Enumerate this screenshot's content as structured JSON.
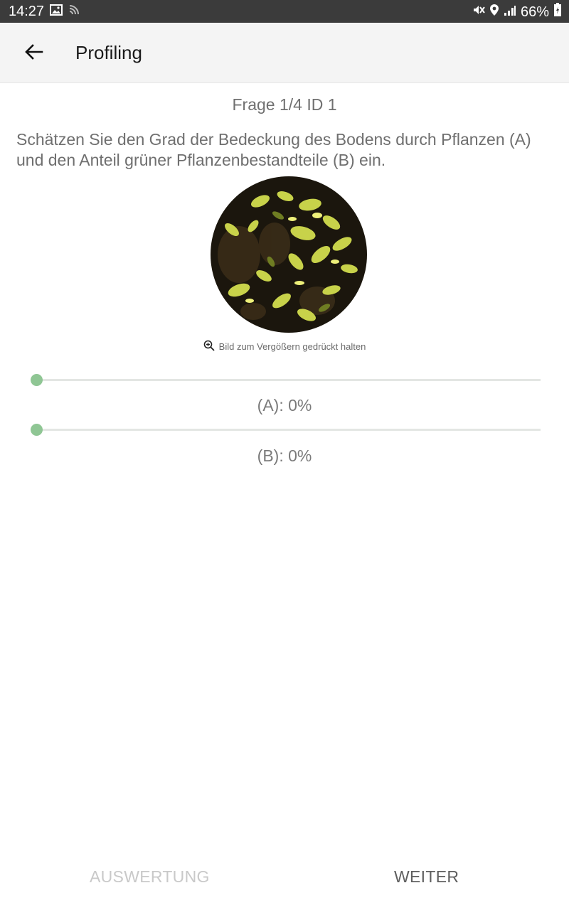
{
  "status_bar": {
    "time": "14:27",
    "battery": "66%",
    "left_icons": [
      "image-icon",
      "cast-icon"
    ],
    "right_icons": [
      "mute-icon",
      "location-icon",
      "signal-icon",
      "battery-icon"
    ]
  },
  "app_bar": {
    "title": "Profiling",
    "back_icon": "arrow-back-icon"
  },
  "question": {
    "header": "Frage 1/4 ID 1",
    "text": "Schätzen Sie den Grad der Bedeckung des Bodens durch Pflanzen (A) und den Anteil grüner Pflanzenbestandteile (B) ein."
  },
  "image": {
    "hint": "Bild zum Vergößern gedrückt halten",
    "hint_icon": "zoom-in-icon"
  },
  "sliders": [
    {
      "label": "(A): 0%",
      "value_percent": 0
    },
    {
      "label": "(B): 0%",
      "value_percent": 0
    }
  ],
  "footer": {
    "left_button": "AUSWERTUNG",
    "right_button": "WEITER"
  },
  "colors": {
    "accent": "#8fc694",
    "status_bar": "#3b3b3b",
    "app_bar": "#f4f4f4",
    "disabled_text": "#c9c9c9"
  }
}
